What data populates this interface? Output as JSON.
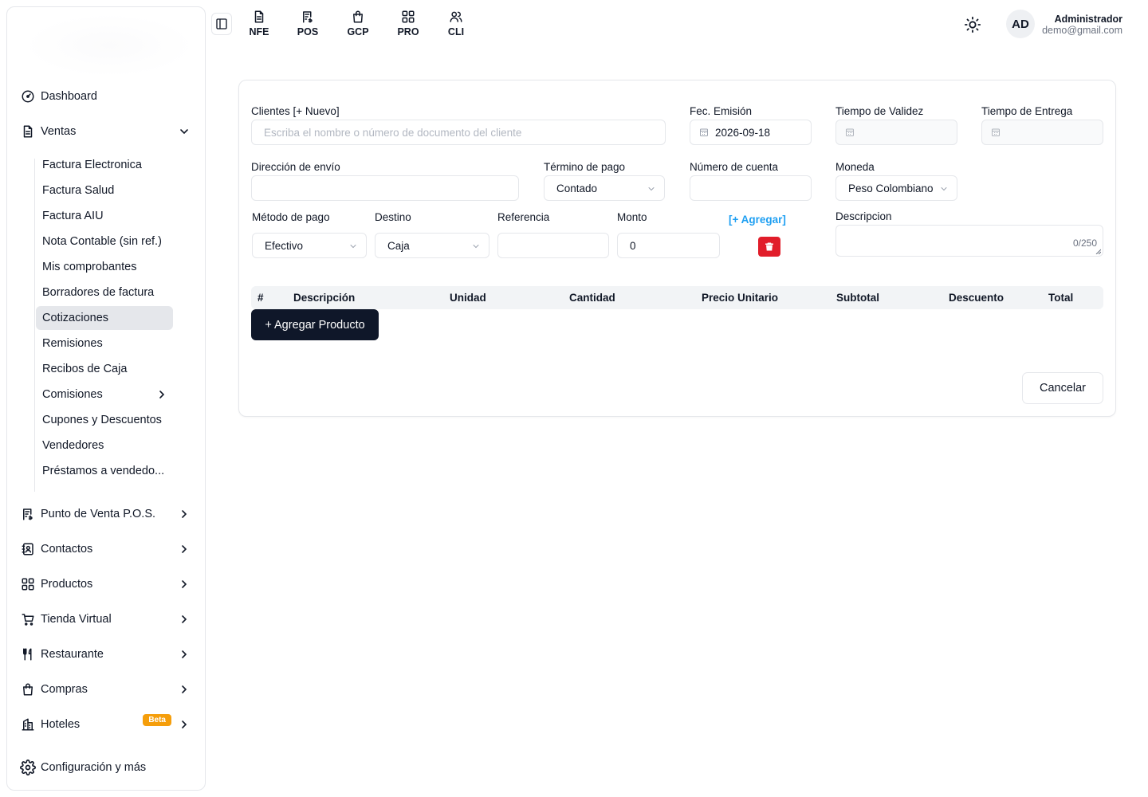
{
  "sidebar": {
    "main_items": [
      {
        "label": "Dashboard",
        "icon": "gauge-icon"
      },
      {
        "label": "Ventas",
        "icon": "document-icon"
      },
      {
        "label": "Punto de Venta P.O.S.",
        "icon": "receipt-icon"
      },
      {
        "label": "Contactos",
        "icon": "contacts-icon"
      },
      {
        "label": "Productos",
        "icon": "grid-icon"
      },
      {
        "label": "Tienda Virtual",
        "icon": "cart-icon"
      },
      {
        "label": "Restaurante",
        "icon": "utensils-icon"
      },
      {
        "label": "Compras",
        "icon": "bag-icon"
      },
      {
        "label": "Hoteles",
        "icon": "hotel-icon",
        "badge": "Beta"
      },
      {
        "label": "Configuración y más",
        "icon": "gear-icon"
      }
    ],
    "ventas_items": [
      {
        "label": "Factura Electronica"
      },
      {
        "label": "Factura Salud"
      },
      {
        "label": "Factura AIU"
      },
      {
        "label": "Nota Contable (sin ref.)"
      },
      {
        "label": "Mis comprobantes"
      },
      {
        "label": "Borradores de factura"
      },
      {
        "label": "Cotizaciones",
        "active": true
      },
      {
        "label": "Remisiones"
      },
      {
        "label": "Recibos de Caja"
      },
      {
        "label": "Comisiones"
      },
      {
        "label": "Cupones y Descuentos"
      },
      {
        "label": "Vendedores"
      },
      {
        "label": "Préstamos a vendedo..."
      }
    ]
  },
  "topbar": {
    "links": [
      {
        "label": "NFE",
        "icon": "document-icon"
      },
      {
        "label": "POS",
        "icon": "receipt-icon"
      },
      {
        "label": "GCP",
        "icon": "bag-icon"
      },
      {
        "label": "PRO",
        "icon": "grid-icon"
      },
      {
        "label": "CLI",
        "icon": "users-icon"
      }
    ],
    "avatar_initials": "AD",
    "user_name": "Administrador",
    "user_email": "demo@gmail.com"
  },
  "form": {
    "clientes_label": "Clientes [+ Nuevo]",
    "clientes_placeholder": "Escriba el nombre o número de documento del cliente",
    "fecha_label": "Fec. Emisión",
    "fecha_value": "2026-09-18",
    "validez_label": "Tiempo de Validez",
    "entrega_label": "Tiempo de Entrega",
    "direccion_label": "Dirección de envío",
    "termino_label": "Término de pago",
    "termino_value": "Contado",
    "cuenta_label": "Número de cuenta",
    "moneda_label": "Moneda",
    "moneda_value": "Peso Colombiano",
    "metodo_label": "Método de pago",
    "metodo_value": "Efectivo",
    "destino_label": "Destino",
    "destino_value": "Caja",
    "referencia_label": "Referencia",
    "monto_label": "Monto",
    "monto_value": "0",
    "agregar_link": "[+ Agregar]",
    "descripcion_label": "Descripcion",
    "descripcion_counter": "0/250"
  },
  "table": {
    "headers": [
      "#",
      "Descripción",
      "Unidad",
      "Cantidad",
      "Precio Unitario",
      "Subtotal",
      "Descuento",
      "Total"
    ]
  },
  "actions": {
    "add_product": "+ Agregar Producto",
    "cancel": "Cancelar"
  },
  "colors": {
    "accent_link": "#1e9ff2",
    "delete": "#e11d2a",
    "primary_button": "#0f1729",
    "beta_badge": "#f59e0b"
  }
}
